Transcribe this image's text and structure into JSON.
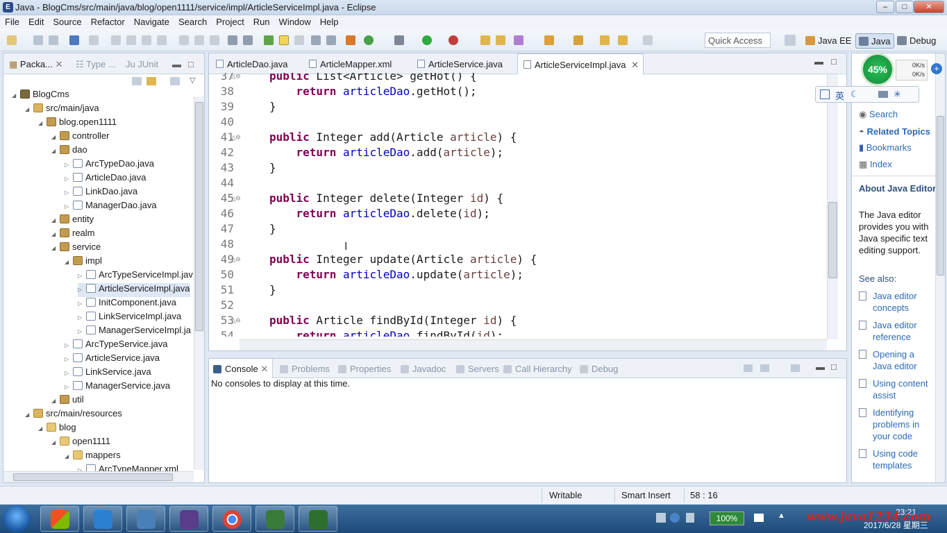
{
  "window": {
    "title": "Java - BlogCms/src/main/java/blog/open1111/service/impl/ArticleServiceImpl.java - Eclipse"
  },
  "menu": [
    "File",
    "Edit",
    "Source",
    "Refactor",
    "Navigate",
    "Search",
    "Project",
    "Run",
    "Window",
    "Help"
  ],
  "quick_access": "Quick Access",
  "perspectives": [
    "Java EE",
    "Java",
    "Debug"
  ],
  "explorer": {
    "tabs": [
      "Packa...",
      "Type ...",
      "JUnit"
    ],
    "tree": [
      {
        "label": "BlogCms",
        "depth": 0,
        "icon": "project-icon"
      },
      {
        "label": "src/main/java",
        "depth": 1,
        "icon": "source-folder-icon"
      },
      {
        "label": "blog.open1111",
        "depth": 2,
        "icon": "package-icon"
      },
      {
        "label": "controller",
        "depth": 3,
        "icon": "package-icon"
      },
      {
        "label": "dao",
        "depth": 3,
        "icon": "package-icon"
      },
      {
        "label": "ArcTypeDao.java",
        "depth": 4,
        "icon": "java-file-icon"
      },
      {
        "label": "ArticleDao.java",
        "depth": 4,
        "icon": "java-file-icon"
      },
      {
        "label": "LinkDao.java",
        "depth": 4,
        "icon": "java-file-icon"
      },
      {
        "label": "ManagerDao.java",
        "depth": 4,
        "icon": "java-file-icon"
      },
      {
        "label": "entity",
        "depth": 3,
        "icon": "package-icon"
      },
      {
        "label": "realm",
        "depth": 3,
        "icon": "package-icon"
      },
      {
        "label": "service",
        "depth": 3,
        "icon": "package-icon"
      },
      {
        "label": "impl",
        "depth": 4,
        "icon": "package-icon"
      },
      {
        "label": "ArcTypeServiceImpl.jav",
        "depth": 5,
        "icon": "java-file-icon"
      },
      {
        "label": "ArticleServiceImpl.java",
        "depth": 5,
        "icon": "java-file-icon"
      },
      {
        "label": "InitComponent.java",
        "depth": 5,
        "icon": "java-file-icon"
      },
      {
        "label": "LinkServiceImpl.java",
        "depth": 5,
        "icon": "java-file-icon"
      },
      {
        "label": "ManagerServiceImpl.ja",
        "depth": 5,
        "icon": "java-file-icon"
      },
      {
        "label": "ArcTypeService.java",
        "depth": 4,
        "icon": "java-file-icon"
      },
      {
        "label": "ArticleService.java",
        "depth": 4,
        "icon": "java-file-icon"
      },
      {
        "label": "LinkService.java",
        "depth": 4,
        "icon": "java-file-icon"
      },
      {
        "label": "ManagerService.java",
        "depth": 4,
        "icon": "java-file-icon"
      },
      {
        "label": "util",
        "depth": 3,
        "icon": "package-icon"
      },
      {
        "label": "src/main/resources",
        "depth": 1,
        "icon": "source-folder-icon"
      },
      {
        "label": "blog",
        "depth": 2,
        "icon": "folder-icon"
      },
      {
        "label": "open1111",
        "depth": 3,
        "icon": "folder-icon"
      },
      {
        "label": "mappers",
        "depth": 4,
        "icon": "folder-icon"
      },
      {
        "label": "ArcTypeMapper.xml",
        "depth": 5,
        "icon": "xml-file-icon"
      }
    ]
  },
  "editor": {
    "tabs": [
      "ArticleDao.java",
      "ArticleMapper.xml",
      "ArticleService.java",
      "ArticleServiceImpl.java"
    ],
    "lines": [
      {
        "n": "37",
        "fold": "△⊖",
        "tokens": [
          [
            "kw",
            "public"
          ],
          [
            "t",
            " List<Article> getHot() {"
          ]
        ]
      },
      {
        "n": "38",
        "tokens": [
          [
            "t",
            "    "
          ],
          [
            "kw",
            "return"
          ],
          [
            "t",
            " "
          ],
          [
            "fd",
            "articleDao"
          ],
          [
            "t",
            ".getHot();"
          ]
        ]
      },
      {
        "n": "39",
        "tokens": [
          [
            "t",
            "}"
          ]
        ]
      },
      {
        "n": "40",
        "tokens": []
      },
      {
        "n": "41",
        "fold": "△⊖",
        "tokens": [
          [
            "kw",
            "public"
          ],
          [
            "t",
            " Integer add(Article "
          ],
          [
            "pr",
            "article"
          ],
          [
            "t",
            ") {"
          ]
        ]
      },
      {
        "n": "42",
        "tokens": [
          [
            "t",
            "    "
          ],
          [
            "kw",
            "return"
          ],
          [
            "t",
            " "
          ],
          [
            "fd",
            "articleDao"
          ],
          [
            "t",
            ".add("
          ],
          [
            "pr",
            "article"
          ],
          [
            "t",
            ");"
          ]
        ]
      },
      {
        "n": "43",
        "tokens": [
          [
            "t",
            "}"
          ]
        ]
      },
      {
        "n": "44",
        "tokens": []
      },
      {
        "n": "45",
        "fold": "△⊖",
        "tokens": [
          [
            "kw",
            "public"
          ],
          [
            "t",
            " Integer delete(Integer "
          ],
          [
            "pr",
            "id"
          ],
          [
            "t",
            ") {"
          ]
        ]
      },
      {
        "n": "46",
        "tokens": [
          [
            "t",
            "    "
          ],
          [
            "kw",
            "return"
          ],
          [
            "t",
            " "
          ],
          [
            "fd",
            "articleDao"
          ],
          [
            "t",
            ".delete("
          ],
          [
            "pr",
            "id"
          ],
          [
            "t",
            ");"
          ]
        ]
      },
      {
        "n": "47",
        "tokens": [
          [
            "t",
            "}"
          ]
        ]
      },
      {
        "n": "48",
        "tokens": []
      },
      {
        "n": "49",
        "fold": "△⊖",
        "tokens": [
          [
            "kw",
            "public"
          ],
          [
            "t",
            " Integer update(Article "
          ],
          [
            "pr",
            "article"
          ],
          [
            "t",
            ") {"
          ]
        ]
      },
      {
        "n": "50",
        "tokens": [
          [
            "t",
            "    "
          ],
          [
            "kw",
            "return"
          ],
          [
            "t",
            " "
          ],
          [
            "fd",
            "articleDao"
          ],
          [
            "t",
            ".update("
          ],
          [
            "pr",
            "article"
          ],
          [
            "t",
            ");"
          ]
        ]
      },
      {
        "n": "51",
        "tokens": [
          [
            "t",
            "}"
          ]
        ]
      },
      {
        "n": "52",
        "tokens": []
      },
      {
        "n": "53",
        "fold": "△⊖",
        "tokens": [
          [
            "kw",
            "public"
          ],
          [
            "t",
            " Article findById(Integer "
          ],
          [
            "pr",
            "id"
          ],
          [
            "t",
            ") {"
          ]
        ]
      },
      {
        "n": "54",
        "tokens": [
          [
            "t",
            "    "
          ],
          [
            "kw",
            "return"
          ],
          [
            "t",
            " "
          ],
          [
            "fd",
            "articleDao"
          ],
          [
            "t",
            ".findById("
          ],
          [
            "pr",
            "id"
          ],
          [
            "t",
            ");"
          ]
        ]
      }
    ]
  },
  "console": {
    "tabs": [
      "Console",
      "Problems",
      "Properties",
      "Javadoc",
      "Servers",
      "Call Hierarchy",
      "Debug"
    ],
    "message": "No consoles to display at this time."
  },
  "help": {
    "links": [
      "Search",
      "Related Topics",
      "Bookmarks",
      "Index"
    ],
    "heading": "About Java Editor",
    "body": "The Java editor provides you with Java specific text editing support.",
    "see_also": "See also:",
    "subtopics": [
      "Java editor concepts",
      "Java editor reference",
      "Opening a Java editor",
      "Using content assist",
      "Identifying problems in your code",
      "Using code templates"
    ]
  },
  "status": {
    "mode": "Writable",
    "insert": "Smart Insert",
    "position": "58 : 16"
  },
  "overlay": {
    "cpu_percent": "45%",
    "up": "0K/s",
    "down": "0K/s",
    "ime_label": "英"
  },
  "taskbar": {
    "battery": "100%",
    "time": "23:21",
    "date": "2017/6/28 星期三"
  },
  "watermark": "www.java1234.com",
  "colors": {
    "keyword": "#7f0055",
    "field": "#0000c0",
    "param": "#6a3e3e",
    "link": "#2a6ab8"
  }
}
